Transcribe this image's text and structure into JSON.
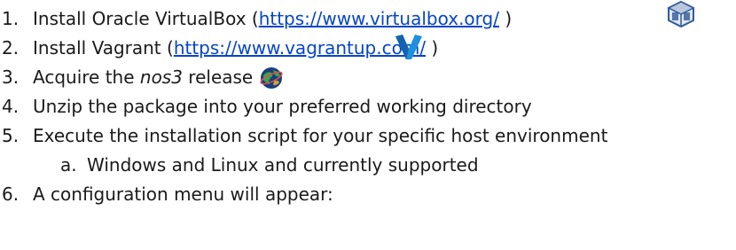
{
  "steps": [
    {
      "number": "1.",
      "text_before": "Install Oracle VirtualBox (",
      "link": "https://www.virtualbox.org/",
      "text_after": " )",
      "icon": "virtualbox-icon"
    },
    {
      "number": "2.",
      "text_before": "Install Vagrant (",
      "link": "https://www.vagrantup.com/",
      "text_after": " )",
      "icon": "vagrant-icon"
    },
    {
      "number": "3.",
      "text_before": "Acquire the ",
      "emphasis": "nos3",
      "text_after": " release",
      "icon": "nos3-globe-icon"
    },
    {
      "number": "4.",
      "text": "Unzip the package into your preferred working directory"
    },
    {
      "number": "5.",
      "text": "Execute the installation script for your specific host environment",
      "substeps": [
        {
          "letter": "a.",
          "text": "Windows and Linux and currently supported"
        }
      ]
    },
    {
      "number": "6.",
      "text": "A configuration menu will appear:"
    }
  ],
  "colors": {
    "text": "#1a1a1a",
    "link": "#0645c8",
    "vagrant_blue": "#1f8fe0",
    "virtualbox_blue": "#2f5b9a"
  }
}
